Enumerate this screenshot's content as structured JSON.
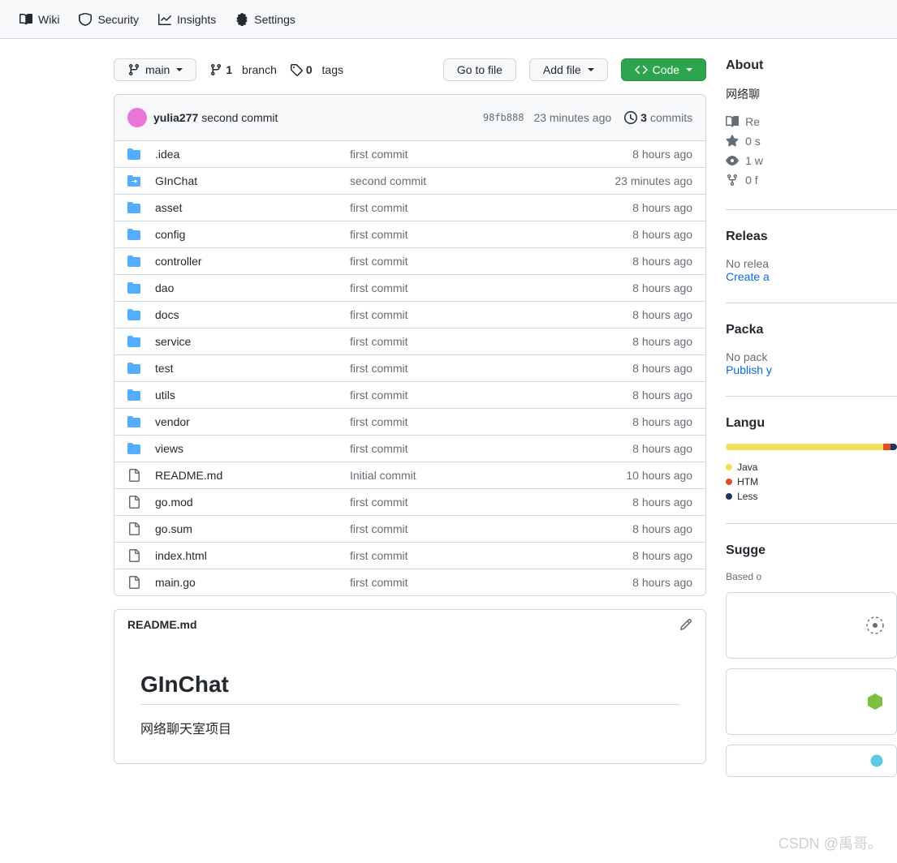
{
  "nav": {
    "items": [
      {
        "label": "Wiki",
        "icon": "book"
      },
      {
        "label": "Security",
        "icon": "shield"
      },
      {
        "label": "Insights",
        "icon": "graph"
      },
      {
        "label": "Settings",
        "icon": "gear"
      }
    ]
  },
  "branch": {
    "current": "main"
  },
  "counts": {
    "branches": "1",
    "branches_label": "branch",
    "tags": "0",
    "tags_label": "tags"
  },
  "buttons": {
    "goto_file": "Go to file",
    "add_file": "Add file",
    "code": "Code"
  },
  "latest_commit": {
    "author": "yulia277",
    "message": "second commit",
    "sha": "98fb888",
    "age": "23 minutes ago",
    "history_count": "3",
    "history_label": "commits"
  },
  "files": [
    {
      "type": "dir",
      "name": ".idea",
      "msg": "first commit",
      "age": "8 hours ago"
    },
    {
      "type": "submodule",
      "name": "GInChat",
      "msg": "second commit",
      "age": "23 minutes ago"
    },
    {
      "type": "dir",
      "name": "asset",
      "msg": "first commit",
      "age": "8 hours ago"
    },
    {
      "type": "dir",
      "name": "config",
      "msg": "first commit",
      "age": "8 hours ago"
    },
    {
      "type": "dir",
      "name": "controller",
      "msg": "first commit",
      "age": "8 hours ago"
    },
    {
      "type": "dir",
      "name": "dao",
      "msg": "first commit",
      "age": "8 hours ago"
    },
    {
      "type": "dir",
      "name": "docs",
      "msg": "first commit",
      "age": "8 hours ago"
    },
    {
      "type": "dir",
      "name": "service",
      "msg": "first commit",
      "age": "8 hours ago"
    },
    {
      "type": "dir",
      "name": "test",
      "msg": "first commit",
      "age": "8 hours ago"
    },
    {
      "type": "dir",
      "name": "utils",
      "msg": "first commit",
      "age": "8 hours ago"
    },
    {
      "type": "dir",
      "name": "vendor",
      "msg": "first commit",
      "age": "8 hours ago"
    },
    {
      "type": "dir",
      "name": "views",
      "msg": "first commit",
      "age": "8 hours ago"
    },
    {
      "type": "file",
      "name": "README.md",
      "msg": "Initial commit",
      "age": "10 hours ago"
    },
    {
      "type": "file",
      "name": "go.mod",
      "msg": "first commit",
      "age": "8 hours ago"
    },
    {
      "type": "file",
      "name": "go.sum",
      "msg": "first commit",
      "age": "8 hours ago"
    },
    {
      "type": "file",
      "name": "index.html",
      "msg": "first commit",
      "age": "8 hours ago"
    },
    {
      "type": "file",
      "name": "main.go",
      "msg": "first commit",
      "age": "8 hours ago"
    }
  ],
  "readme": {
    "filename": "README.md",
    "title": "GInChat",
    "body": "网络聊天室项目"
  },
  "about": {
    "title": "About",
    "description": "网络聊",
    "items": [
      {
        "icon": "book",
        "text": "Re"
      },
      {
        "icon": "star",
        "text": "0 s"
      },
      {
        "icon": "eye",
        "text": "1 w"
      },
      {
        "icon": "fork",
        "text": "0 f"
      }
    ]
  },
  "releases": {
    "title": "Releas",
    "empty": "No relea",
    "link": "Create a"
  },
  "packages": {
    "title": "Packa",
    "empty": "No pack",
    "link": "Publish y"
  },
  "languages": {
    "title": "Langu",
    "bar": [
      {
        "color": "#f1e05a",
        "pct": 92
      },
      {
        "color": "#e34c26",
        "pct": 4
      },
      {
        "color": "#1d365d",
        "pct": 4
      }
    ],
    "items": [
      {
        "name": "Java",
        "color": "#f1e05a"
      },
      {
        "name": "HTM",
        "color": "#e34c26"
      },
      {
        "name": "Less",
        "color": "#1d365d"
      }
    ]
  },
  "suggested": {
    "title": "Sugge",
    "sub": "Based o"
  },
  "watermark": "CSDN @禹哥。"
}
